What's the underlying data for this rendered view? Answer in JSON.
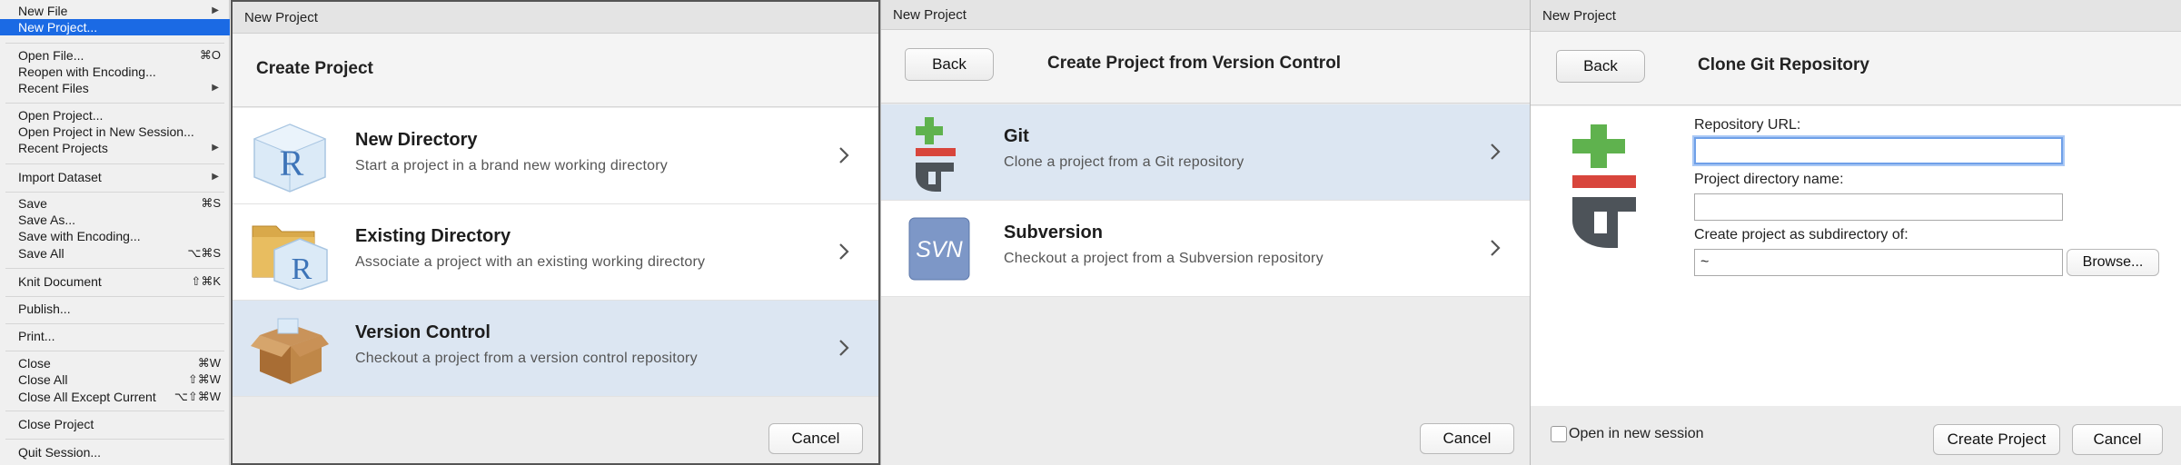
{
  "file_menu": {
    "items": [
      {
        "label": "New File",
        "shortcut": "",
        "submenu": true
      },
      {
        "label": "New Project...",
        "shortcut": "",
        "submenu": false
      },
      {
        "label": "Open File...",
        "shortcut": "⌘O",
        "submenu": false
      },
      {
        "label": "Reopen with Encoding...",
        "shortcut": "",
        "submenu": false
      },
      {
        "label": "Recent Files",
        "shortcut": "",
        "submenu": true
      },
      {
        "label": "Open Project...",
        "shortcut": "",
        "submenu": false
      },
      {
        "label": "Open Project in New Session...",
        "shortcut": "",
        "submenu": false
      },
      {
        "label": "Recent Projects",
        "shortcut": "",
        "submenu": true
      },
      {
        "label": "Import Dataset",
        "shortcut": "",
        "submenu": true
      },
      {
        "label": "Save",
        "shortcut": "⌘S",
        "submenu": false
      },
      {
        "label": "Save As...",
        "shortcut": "",
        "submenu": false
      },
      {
        "label": "Save with Encoding...",
        "shortcut": "",
        "submenu": false
      },
      {
        "label": "Save All",
        "shortcut": "⌥⌘S",
        "submenu": false
      },
      {
        "label": "Knit Document",
        "shortcut": "⇧⌘K",
        "submenu": false
      },
      {
        "label": "Publish...",
        "shortcut": "",
        "submenu": false
      },
      {
        "label": "Print...",
        "shortcut": "",
        "submenu": false
      },
      {
        "label": "Close",
        "shortcut": "⌘W",
        "submenu": false
      },
      {
        "label": "Close All",
        "shortcut": "⇧⌘W",
        "submenu": false
      },
      {
        "label": "Close All Except Current",
        "shortcut": "⌥⇧⌘W",
        "submenu": false
      },
      {
        "label": "Close Project",
        "shortcut": "",
        "submenu": false
      },
      {
        "label": "Quit Session...",
        "shortcut": "",
        "submenu": false
      }
    ],
    "submenu_arrow": "▶"
  },
  "dialog1": {
    "window_title": "New Project",
    "header": "Create Project",
    "options": [
      {
        "title": "New Directory",
        "subtitle": "Start a project in a brand new working directory",
        "icon": "r-cube-icon"
      },
      {
        "title": "Existing Directory",
        "subtitle": "Associate a project with an existing working directory",
        "icon": "folder-r-icon"
      },
      {
        "title": "Version Control",
        "subtitle": "Checkout a project from a version control repository",
        "icon": "box-icon"
      }
    ],
    "cancel": "Cancel",
    "r_letter": "R"
  },
  "dialog2": {
    "window_title": "New Project",
    "back": "Back",
    "header": "Create Project from Version Control",
    "options": [
      {
        "title": "Git",
        "subtitle": "Clone a project from a Git repository",
        "icon": "git-icon"
      },
      {
        "title": "Subversion",
        "subtitle": "Checkout a project from a Subversion repository",
        "icon": "svn-icon"
      }
    ],
    "svn_text": "SVN",
    "cancel": "Cancel"
  },
  "dialog3": {
    "window_title": "New Project",
    "back": "Back",
    "header": "Clone Git Repository",
    "repo_url_label": "Repository URL:",
    "repo_url_value": "",
    "dir_name_label": "Project directory name:",
    "dir_name_value": "",
    "subdir_label": "Create project as subdirectory of:",
    "subdir_value": "~",
    "browse": "Browse...",
    "open_new_session": "Open in new session",
    "create": "Create Project",
    "cancel": "Cancel"
  },
  "colors": {
    "menu_selection": "#1b6ae4",
    "row_selected": "#dce6f2",
    "git_green": "#5fb24e",
    "git_red": "#d8453c",
    "git_gray": "#4d5359",
    "svn_blue": "#7d97c7"
  }
}
